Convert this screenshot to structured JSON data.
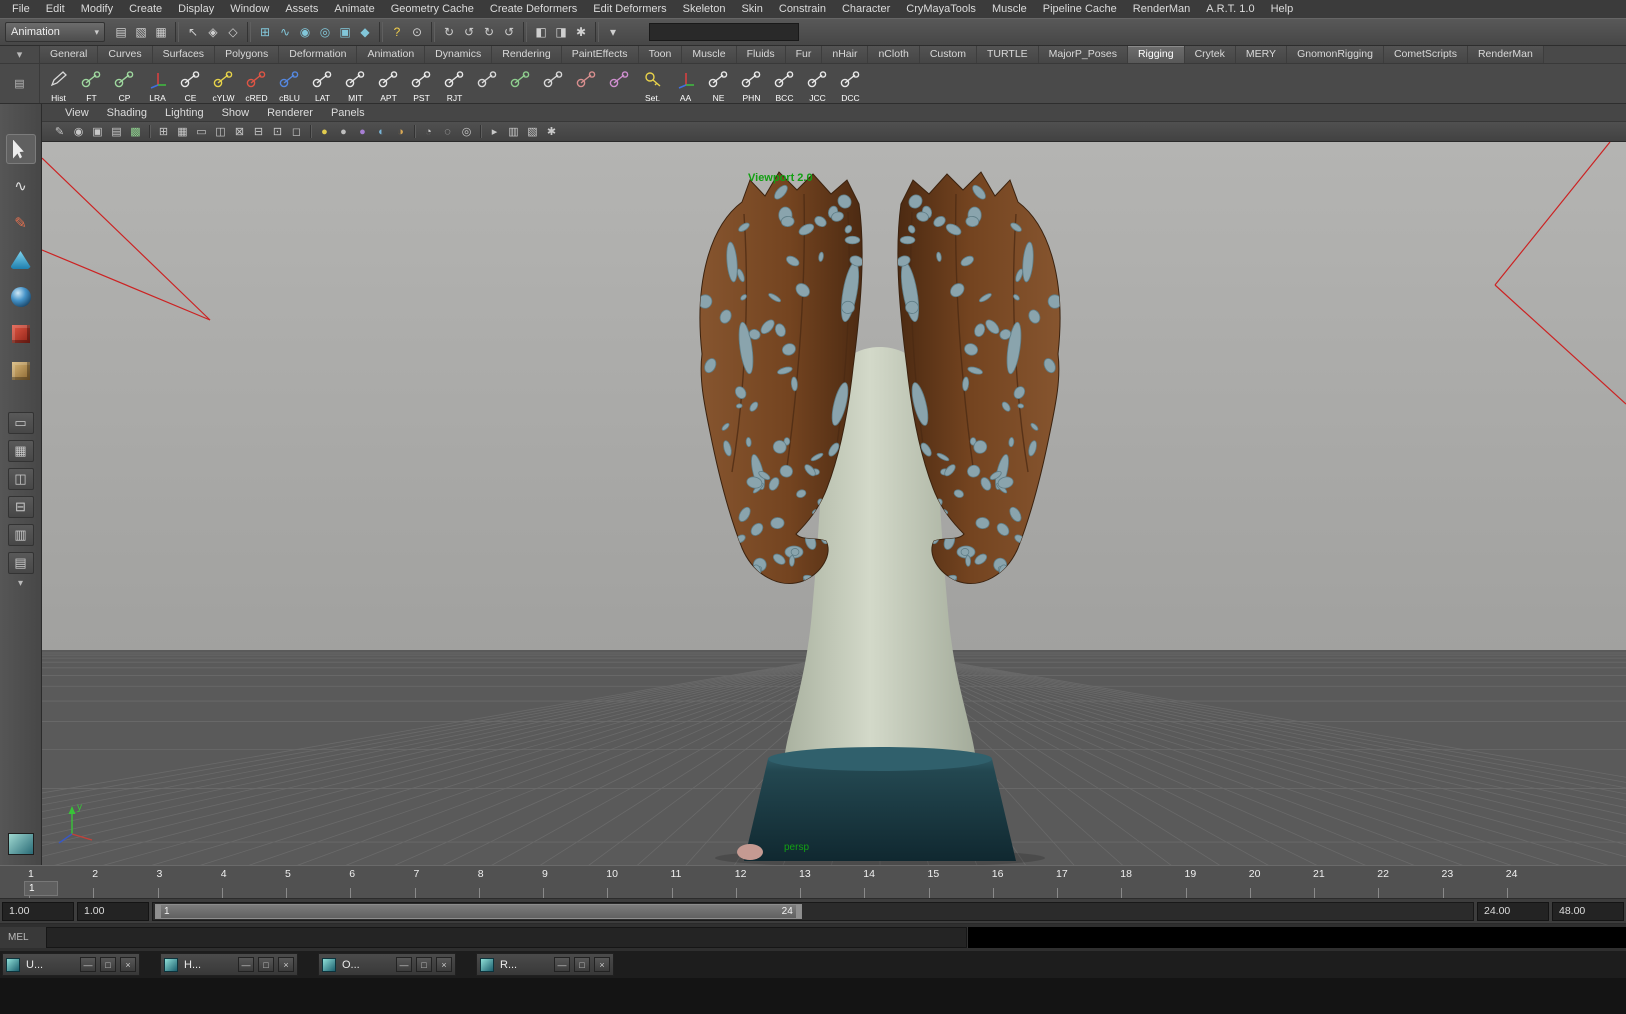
{
  "icons": {
    "chevron_down": "▾"
  },
  "menu_bar": {
    "items": [
      "File",
      "Edit",
      "Modify",
      "Create",
      "Display",
      "Window",
      "Assets",
      "Animate",
      "Geometry Cache",
      "Create Deformers",
      "Edit Deformers",
      "Skeleton",
      "Skin",
      "Constrain",
      "Character",
      "CryMayaTools",
      "Muscle",
      "Pipeline Cache",
      "RenderMan",
      "A.R.T. 1.0",
      "Help"
    ]
  },
  "status_line": {
    "menuset_value": "Animation",
    "input_value": "",
    "groups": [
      {
        "name": "file",
        "icons": [
          {
            "name": "new-scene-icon",
            "glyph": "▤"
          },
          {
            "name": "open-scene-icon",
            "glyph": "▧"
          },
          {
            "name": "save-scene-icon",
            "glyph": "▦"
          }
        ]
      },
      {
        "name": "selection-mode",
        "icons": [
          {
            "name": "select-hierarchy-icon",
            "glyph": "↖"
          },
          {
            "name": "select-object-icon",
            "glyph": "◈"
          },
          {
            "name": "select-component-icon",
            "glyph": "◇"
          }
        ]
      },
      {
        "name": "snapping",
        "icons": [
          {
            "name": "snap-grid-icon",
            "glyph": "⊞",
            "color": "#82c7da"
          },
          {
            "name": "snap-curve-icon",
            "glyph": "∿",
            "color": "#82c7da"
          },
          {
            "name": "snap-point-icon",
            "glyph": "◉",
            "color": "#82c7da"
          },
          {
            "name": "snap-projected-center-icon",
            "glyph": "◎",
            "color": "#82c7da"
          },
          {
            "name": "snap-view-plane-icon",
            "glyph": "▣",
            "color": "#82c7da"
          },
          {
            "name": "make-live-icon",
            "glyph": "◆",
            "color": "#82c7da"
          }
        ]
      },
      {
        "name": "misc",
        "icons": [
          {
            "name": "help-icon",
            "glyph": "?",
            "color": "#f3cf4b"
          },
          {
            "name": "highlight-selection-icon",
            "glyph": "⊙"
          }
        ]
      },
      {
        "name": "connections",
        "icons": [
          {
            "name": "input-connections-icon",
            "glyph": "↻"
          },
          {
            "name": "output-connections-icon",
            "glyph": "↺"
          },
          {
            "name": "history-toggle-icon",
            "glyph": "↻"
          },
          {
            "name": "refresh-icon",
            "glyph": "↺"
          }
        ]
      },
      {
        "name": "render",
        "icons": [
          {
            "name": "render-current-frame-icon",
            "glyph": "◧"
          },
          {
            "name": "ipr-render-icon",
            "glyph": "◨"
          },
          {
            "name": "render-settings-icon",
            "glyph": "✱"
          }
        ]
      },
      {
        "name": "field-mode",
        "icons": [
          {
            "name": "input-field-mode-icon",
            "glyph": "▾"
          }
        ]
      }
    ]
  },
  "shelf": {
    "gutter_icons": [
      {
        "name": "shelf-tab-selector-icon",
        "glyph": "▾"
      },
      {
        "name": "shelf-editor-icon",
        "glyph": "▤"
      }
    ],
    "tabs": [
      "General",
      "Curves",
      "Surfaces",
      "Polygons",
      "Deformation",
      "Animation",
      "Dynamics",
      "Rendering",
      "PaintEffects",
      "Toon",
      "Muscle",
      "Fluids",
      "Fur",
      "nHair",
      "nCloth",
      "Custom",
      "TURTLE",
      "MajorP_Poses",
      "Rigging",
      "Crytek",
      "MERY",
      "GnomonRigging",
      "CometScripts",
      "RenderMan"
    ],
    "active_tab": "Rigging",
    "buttons": [
      {
        "label": "Hist",
        "icon": "pencil",
        "color": "#d8d8d8"
      },
      {
        "label": "FT",
        "icon": "joint",
        "color": "#9fd89f"
      },
      {
        "label": "CP",
        "icon": "joint",
        "color": "#9fd89f"
      },
      {
        "label": "LRA",
        "icon": "axis"
      },
      {
        "label": "CE",
        "icon": "joint",
        "color": "#e8e8e8"
      },
      {
        "label": "cYLW",
        "icon": "joint",
        "color": "#e8d44a"
      },
      {
        "label": "cRED",
        "icon": "joint",
        "color": "#e05545"
      },
      {
        "label": "cBLU",
        "icon": "joint",
        "color": "#5588e0"
      },
      {
        "label": "LAT",
        "icon": "joint",
        "color": "#e8e8e8"
      },
      {
        "label": "MIT",
        "icon": "joint",
        "color": "#e8e8e8"
      },
      {
        "label": "APT",
        "icon": "joint",
        "color": "#e8e8e8"
      },
      {
        "label": "PST",
        "icon": "joint",
        "color": "#e8e8e8"
      },
      {
        "label": "RJT",
        "icon": "joint",
        "color": "#e8e8e8"
      },
      {
        "label": "",
        "icon": "joint",
        "color": "#d9d9d9"
      },
      {
        "label": "",
        "icon": "joint",
        "color": "#8fcf8f"
      },
      {
        "label": "",
        "icon": "joint",
        "color": "#d9d9d9"
      },
      {
        "label": "",
        "icon": "joint",
        "color": "#d98f8f"
      },
      {
        "label": "",
        "icon": "joint",
        "color": "#cf8fcf"
      },
      {
        "label": "Set.",
        "icon": "key",
        "color": "#e8d24a"
      },
      {
        "label": "AA",
        "icon": "axis"
      },
      {
        "label": "NE",
        "icon": "joint",
        "color": "#e8e8e8"
      },
      {
        "label": "PHN",
        "icon": "joint",
        "color": "#e8e8e8"
      },
      {
        "label": "BCC",
        "icon": "joint",
        "color": "#e8e8e8"
      },
      {
        "label": "JCC",
        "icon": "joint",
        "color": "#e8e8e8"
      },
      {
        "label": "DCC",
        "icon": "joint",
        "color": "#e8e8e8"
      }
    ]
  },
  "toolbox": {
    "active_tool": "select-tool",
    "more_arrow": "▾",
    "tools": [
      {
        "name": "select-tool",
        "kind": "cursor"
      },
      {
        "name": "lasso-tool",
        "kind": "glyph",
        "glyph": "∿",
        "color": "#e0e0e0"
      },
      {
        "name": "paint-select-tool",
        "kind": "glyph",
        "glyph": "✎",
        "color": "#e07050"
      },
      {
        "name": "move-tool",
        "kind": "cone"
      },
      {
        "name": "rotate-tool",
        "kind": "ball"
      },
      {
        "name": "scale-tool",
        "kind": "cube"
      },
      {
        "name": "last-tool-used",
        "kind": "cube-tan"
      }
    ],
    "layouts": [
      {
        "name": "layout-single-pane",
        "glyph": "▭"
      },
      {
        "name": "layout-four-pane",
        "glyph": "▦"
      },
      {
        "name": "layout-two-pane-side",
        "glyph": "◫"
      },
      {
        "name": "layout-two-pane-stacked",
        "glyph": "⊟"
      },
      {
        "name": "layout-pane-outliner",
        "glyph": "▥"
      },
      {
        "name": "layout-pane-graph",
        "glyph": "▤"
      }
    ]
  },
  "panel": {
    "menus": [
      "View",
      "Shading",
      "Lighting",
      "Show",
      "Renderer",
      "Panels"
    ],
    "icons": [
      {
        "name": "grease-pencil-icon",
        "glyph": "✎"
      },
      {
        "name": "camera-select-icon",
        "glyph": "◉"
      },
      {
        "name": "camera-attributes-icon",
        "glyph": "▣"
      },
      {
        "name": "bookmarks-icon",
        "glyph": "▤"
      },
      {
        "name": "image-plane-icon",
        "glyph": "▩",
        "color": "#8fcf8f"
      },
      {
        "sep": true
      },
      {
        "name": "2d-pan-zoom-icon",
        "glyph": "⊞"
      },
      {
        "name": "grid-icon",
        "glyph": "▦"
      },
      {
        "name": "film-gate-icon",
        "glyph": "▭"
      },
      {
        "name": "resolution-gate-icon",
        "glyph": "◫"
      },
      {
        "name": "gate-mask-icon",
        "glyph": "⊠"
      },
      {
        "name": "field-chart-icon",
        "glyph": "⊟"
      },
      {
        "name": "safe-action-icon",
        "glyph": "⊡"
      },
      {
        "name": "safe-title-icon",
        "glyph": "◻"
      },
      {
        "sep": true
      },
      {
        "name": "lighting-all-icon",
        "glyph": "●",
        "color": "#e2cc4e"
      },
      {
        "name": "lighting-default-icon",
        "glyph": "●",
        "color": "#bfbfbf"
      },
      {
        "name": "lighting-none-icon",
        "glyph": "●",
        "color": "#a77fd4"
      },
      {
        "name": "shadows-icon",
        "glyph": "◐",
        "color": "#78b4d6"
      },
      {
        "name": "ssao-icon",
        "glyph": "◑",
        "color": "#d8a855"
      },
      {
        "sep": true
      },
      {
        "name": "isolate-select-icon",
        "glyph": "◔"
      },
      {
        "name": "xray-icon",
        "glyph": "◌"
      },
      {
        "name": "xray-joints-icon",
        "glyph": "◎"
      },
      {
        "sep": true
      },
      {
        "name": "scene-view-icon",
        "glyph": "▸"
      },
      {
        "name": "outliner-toggle-icon",
        "glyph": "▥"
      },
      {
        "name": "hypergraph-toggle-icon",
        "glyph": "▧"
      },
      {
        "name": "share-icon",
        "glyph": "✱"
      }
    ]
  },
  "viewport": {
    "label": "Viewport 2.0",
    "camera": "persp",
    "axis_label": "y",
    "colors": {
      "bg_top": "#b4b4b2",
      "bg_bottom": "#a1a19f",
      "floor": "#5a5a5a",
      "grid": "#6a6a6a",
      "frustum": "#cc2222",
      "pedestal": "#24434c",
      "bust": "#c9cfc0",
      "horn": "#7a4a28",
      "blob": "#8aa4ad",
      "label_color": "#13a013"
    }
  },
  "time_slider": {
    "start": 1,
    "end": 24,
    "current": "1"
  },
  "range_slider": {
    "start_frame": "1.00",
    "playback_start": "1.00",
    "bar_start": "1",
    "bar_end": "24",
    "playback_end": "24.00",
    "end_frame": "48.00"
  },
  "command_line": {
    "label": "MEL",
    "value": ""
  },
  "taskbar": {
    "items": [
      {
        "title": "U..."
      },
      {
        "title": "H..."
      },
      {
        "title": "O..."
      },
      {
        "title": "R..."
      }
    ],
    "window_buttons": [
      {
        "name": "minimize-icon",
        "glyph": "—"
      },
      {
        "name": "restore-icon",
        "glyph": "□"
      },
      {
        "name": "close-icon",
        "glyph": "×"
      }
    ]
  }
}
